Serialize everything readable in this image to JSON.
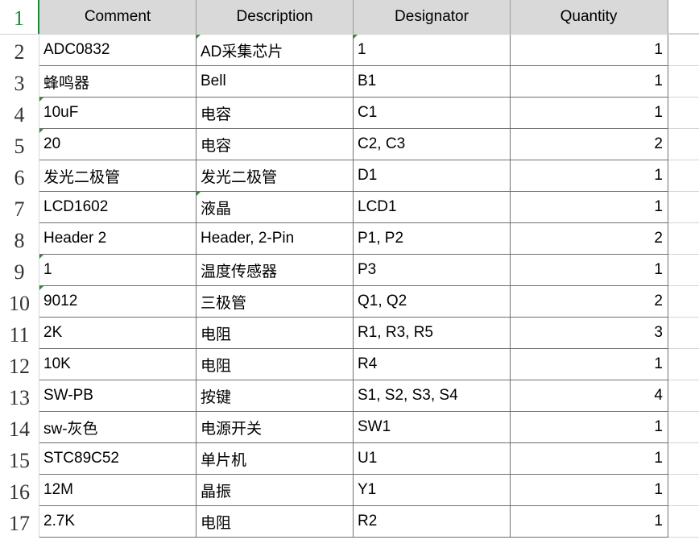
{
  "sheet": {
    "header": {
      "row_number": "1",
      "columns": [
        "Comment",
        "Description",
        "Designator",
        "Quantity"
      ]
    },
    "rows": [
      {
        "num": "2",
        "comment": "ADC0832",
        "description": "AD采集芯片",
        "designator": "1",
        "quantity": "1",
        "marks": [
          false,
          true,
          true
        ]
      },
      {
        "num": "3",
        "comment": "蜂鸣器",
        "description": "Bell",
        "designator": "B1",
        "quantity": "1",
        "marks": [
          false,
          false,
          false
        ]
      },
      {
        "num": "4",
        "comment": "10uF",
        "description": "电容",
        "designator": "C1",
        "quantity": "1",
        "marks": [
          true,
          false,
          false
        ]
      },
      {
        "num": "5",
        "comment": "20",
        "description": "电容",
        "designator": "C2, C3",
        "quantity": "2",
        "marks": [
          true,
          false,
          false
        ]
      },
      {
        "num": "6",
        "comment": "发光二极管",
        "description": "发光二极管",
        "designator": "D1",
        "quantity": "1",
        "marks": [
          false,
          false,
          false
        ]
      },
      {
        "num": "7",
        "comment": "LCD1602",
        "description": "液晶",
        "designator": "LCD1",
        "quantity": "1",
        "marks": [
          false,
          true,
          false
        ]
      },
      {
        "num": "8",
        "comment": "Header 2",
        "description": "Header, 2-Pin",
        "designator": "P1, P2",
        "quantity": "2",
        "marks": [
          false,
          false,
          false
        ]
      },
      {
        "num": "9",
        "comment": "1",
        "description": "温度传感器",
        "designator": "P3",
        "quantity": "1",
        "marks": [
          true,
          false,
          false
        ]
      },
      {
        "num": "10",
        "comment": "9012",
        "description": "三极管",
        "designator": "Q1, Q2",
        "quantity": "2",
        "marks": [
          true,
          false,
          false
        ]
      },
      {
        "num": "11",
        "comment": "2K",
        "description": "电阻",
        "designator": "R1, R3, R5",
        "quantity": "3",
        "marks": [
          false,
          false,
          false
        ]
      },
      {
        "num": "12",
        "comment": "10K",
        "description": "电阻",
        "designator": "R4",
        "quantity": "1",
        "marks": [
          false,
          false,
          false
        ]
      },
      {
        "num": "13",
        "comment": "SW-PB",
        "description": "按键",
        "designator": "S1, S2, S3, S4",
        "quantity": "4",
        "marks": [
          false,
          false,
          false
        ]
      },
      {
        "num": "14",
        "comment": "sw-灰色",
        "description": "电源开关",
        "designator": "SW1",
        "quantity": "1",
        "marks": [
          false,
          false,
          false
        ]
      },
      {
        "num": "15",
        "comment": "STC89C52",
        "description": "单片机",
        "designator": "U1",
        "quantity": "1",
        "marks": [
          false,
          false,
          false
        ]
      },
      {
        "num": "16",
        "comment": "12M",
        "description": "晶振",
        "designator": "Y1",
        "quantity": "1",
        "marks": [
          false,
          false,
          false
        ]
      },
      {
        "num": "17",
        "comment": "2.7K",
        "description": "电阻",
        "designator": "R2",
        "quantity": "1",
        "marks": [
          false,
          false,
          false
        ]
      }
    ]
  },
  "colors": {
    "header_bg": "#d9d9d9",
    "selected_row_number": "#1a8a3a",
    "comment_marker": "#2e8b3c"
  }
}
